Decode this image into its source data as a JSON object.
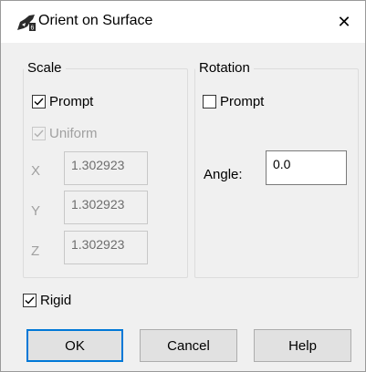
{
  "window": {
    "title": "Orient on Surface",
    "close_symbol": "✕"
  },
  "scale": {
    "label": "Scale",
    "prompt_label": "Prompt",
    "prompt_checked": true,
    "uniform_label": "Uniform",
    "uniform_checked": true,
    "x_label": "X",
    "x_value": "1.302923",
    "y_label": "Y",
    "y_value": "1.302923",
    "z_label": "Z",
    "z_value": "1.302923"
  },
  "rotation": {
    "label": "Rotation",
    "prompt_label": "Prompt",
    "prompt_checked": false,
    "angle_label": "Angle:",
    "angle_value": "0.0"
  },
  "rigid": {
    "label": "Rigid",
    "checked": true
  },
  "buttons": {
    "ok": "OK",
    "cancel": "Cancel",
    "help": "Help"
  },
  "colors": {
    "accent": "#0078d7",
    "disabled_text": "#a0a0a0",
    "dialog_bg": "#f0f0f0"
  }
}
